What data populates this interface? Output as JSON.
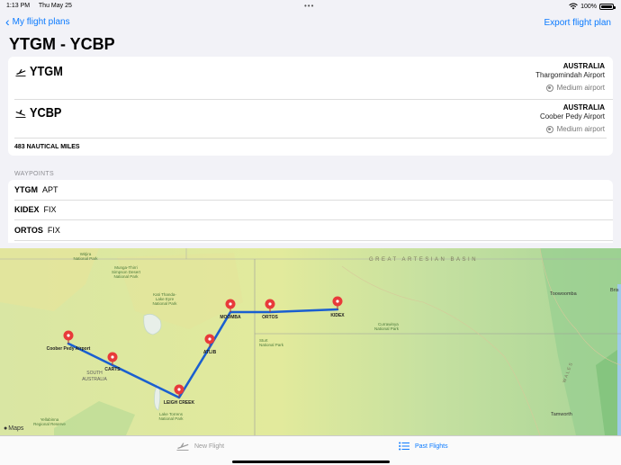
{
  "status_bar": {
    "time": "1:13 PM",
    "date": "Thu May 25",
    "battery": "100%"
  },
  "nav": {
    "back_label": "My flight plans",
    "export_label": "Export flight plan"
  },
  "page_title": "YTGM - YCBP",
  "departure": {
    "icao": "YTGM",
    "country": "AUSTRALIA",
    "name": "Thargomindah Airport",
    "type": "Medium airport"
  },
  "arrival": {
    "icao": "YCBP",
    "country": "AUSTRALIA",
    "name": "Coober Pedy Airport",
    "type": "Medium airport"
  },
  "distance": "483 NAUTICAL MILES",
  "waypoints_header": "WAYPOINTS",
  "waypoints": [
    {
      "id": "YTGM",
      "kind": "APT"
    },
    {
      "id": "KIDEX",
      "kind": "FIX"
    },
    {
      "id": "ORTOS",
      "kind": "FIX"
    }
  ],
  "map": {
    "route_color": "#1a5fd0",
    "pin_color": "#e83a3a",
    "pins": {
      "kidex": "KIDEX",
      "ortos": "ORTOS",
      "moomba": "MOOMBA",
      "atlib": "ATLIB",
      "leigh_creek": "LEIGH CREEK",
      "carts": "CARTS",
      "coober_pedy": "Coober Pedy Airport"
    },
    "labels": {
      "great_artesian": "GREAT ARTESIAN BASIN",
      "witjira_1": "Witjira",
      "witjira_2": "National Park",
      "munga_1": "Munga-Thirri",
      "munga_2": "Simpson Desert",
      "munga_3": "National Park",
      "kati_1": "Kati Thanda-",
      "kati_2": "Lake Eyre",
      "kati_3": "National Park",
      "sturt_1": "Sturt",
      "sturt_2": "National Park",
      "currawinya_1": "Currawinya",
      "currawinya_2": "National Park",
      "south_aus_1": "SOUTH",
      "south_aus_2": "AUSTRALIA",
      "torrens_1": "Lake Torrens",
      "torrens_2": "National Park",
      "yellabinna_1": "Yellabinna",
      "yellabinna_2": "Regional Reserve",
      "toowoomba": "Toowoomba",
      "brisbane": "Bris",
      "tamworth": "Tamworth",
      "wales": "WALES"
    },
    "attribution": "Maps"
  },
  "tabs": {
    "new_flight": "New Flight",
    "past_flights": "Past Flights"
  }
}
